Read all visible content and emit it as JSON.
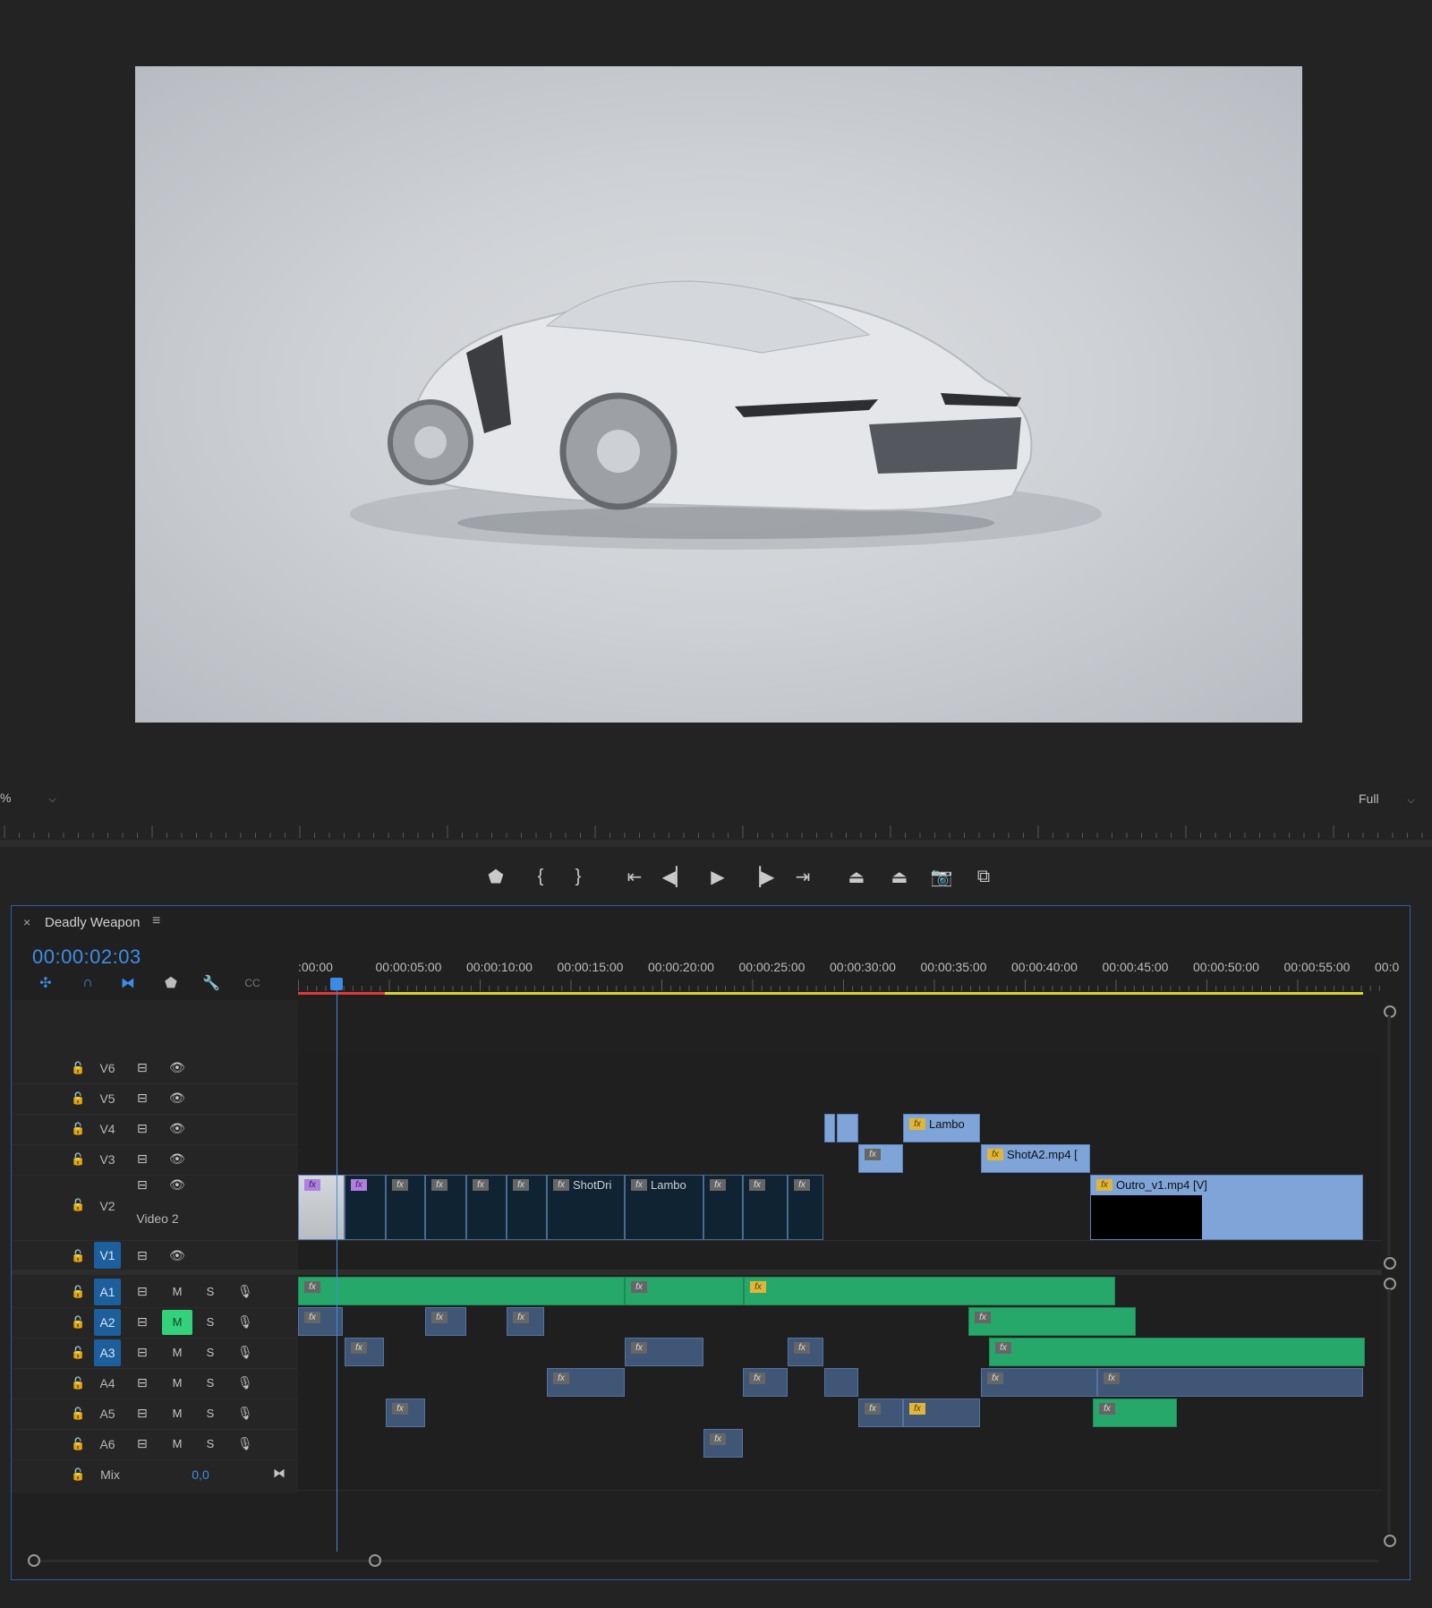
{
  "monitor": {
    "zoom_label": "%",
    "quality_label": "Full",
    "transport": [
      {
        "name": "add-marker-button",
        "glyph": "⬟"
      },
      {
        "name": "mark-in-button",
        "glyph": "{"
      },
      {
        "name": "mark-out-button",
        "glyph": "}"
      },
      {
        "name": "go-to-in-button",
        "glyph": "⇤"
      },
      {
        "name": "step-back-button",
        "glyph": "◀▏"
      },
      {
        "name": "play-button",
        "glyph": "▶"
      },
      {
        "name": "step-forward-button",
        "glyph": "▕▶"
      },
      {
        "name": "go-to-out-button",
        "glyph": "⇥"
      },
      {
        "name": "lift-button",
        "glyph": "⏏"
      },
      {
        "name": "extract-button",
        "glyph": "⏏"
      },
      {
        "name": "export-frame-button",
        "glyph": "📷"
      },
      {
        "name": "comparison-view-button",
        "glyph": "⧉"
      }
    ]
  },
  "timeline": {
    "close_glyph": "×",
    "sequence_name": "Deadly Weapon",
    "menu_glyph": "≡",
    "timecode": "00:00:02:03",
    "ruler": [
      ":00:00",
      "00:00:05:00",
      "00:00:10:00",
      "00:00:15:00",
      "00:00:20:00",
      "00:00:25:00",
      "00:00:30:00",
      "00:00:35:00",
      "00:00:40:00",
      "00:00:45:00",
      "00:00:50:00",
      "00:00:55:00",
      "00:0"
    ],
    "video_tracks": [
      {
        "id": "V6",
        "label": "V6"
      },
      {
        "id": "V5",
        "label": "V5"
      },
      {
        "id": "V4",
        "label": "V4"
      },
      {
        "id": "V3",
        "label": "V3"
      },
      {
        "id": "V2",
        "label": "V2",
        "name": "Video 2"
      },
      {
        "id": "V1",
        "label": "V1"
      }
    ],
    "audio_tracks": [
      {
        "id": "A1",
        "label": "A1",
        "m": "M",
        "s": "S"
      },
      {
        "id": "A2",
        "label": "A2",
        "m": "M",
        "s": "S"
      },
      {
        "id": "A3",
        "label": "A3",
        "m": "M",
        "s": "S"
      },
      {
        "id": "A4",
        "label": "A4",
        "m": "M",
        "s": "S"
      },
      {
        "id": "A5",
        "label": "A5",
        "m": "M",
        "s": "S"
      },
      {
        "id": "A6",
        "label": "A6",
        "m": "M",
        "s": "S"
      }
    ],
    "mix": {
      "label": "Mix",
      "value": "0,0"
    },
    "clips": {
      "v4_lambo": "Lambo",
      "v3_shota2": "ShotA2.mp4 [",
      "v2_shotdri": "ShotDri",
      "v2_lambo": "Lambo",
      "v2_outro": "Outro_v1.mp4 [V]"
    },
    "fx_label": "fx"
  },
  "colors": {
    "accent": "#3d8ee8",
    "audio_clip": "#26a86a",
    "video_clip": "#7ea4d8",
    "mute_on": "#33d17a"
  }
}
